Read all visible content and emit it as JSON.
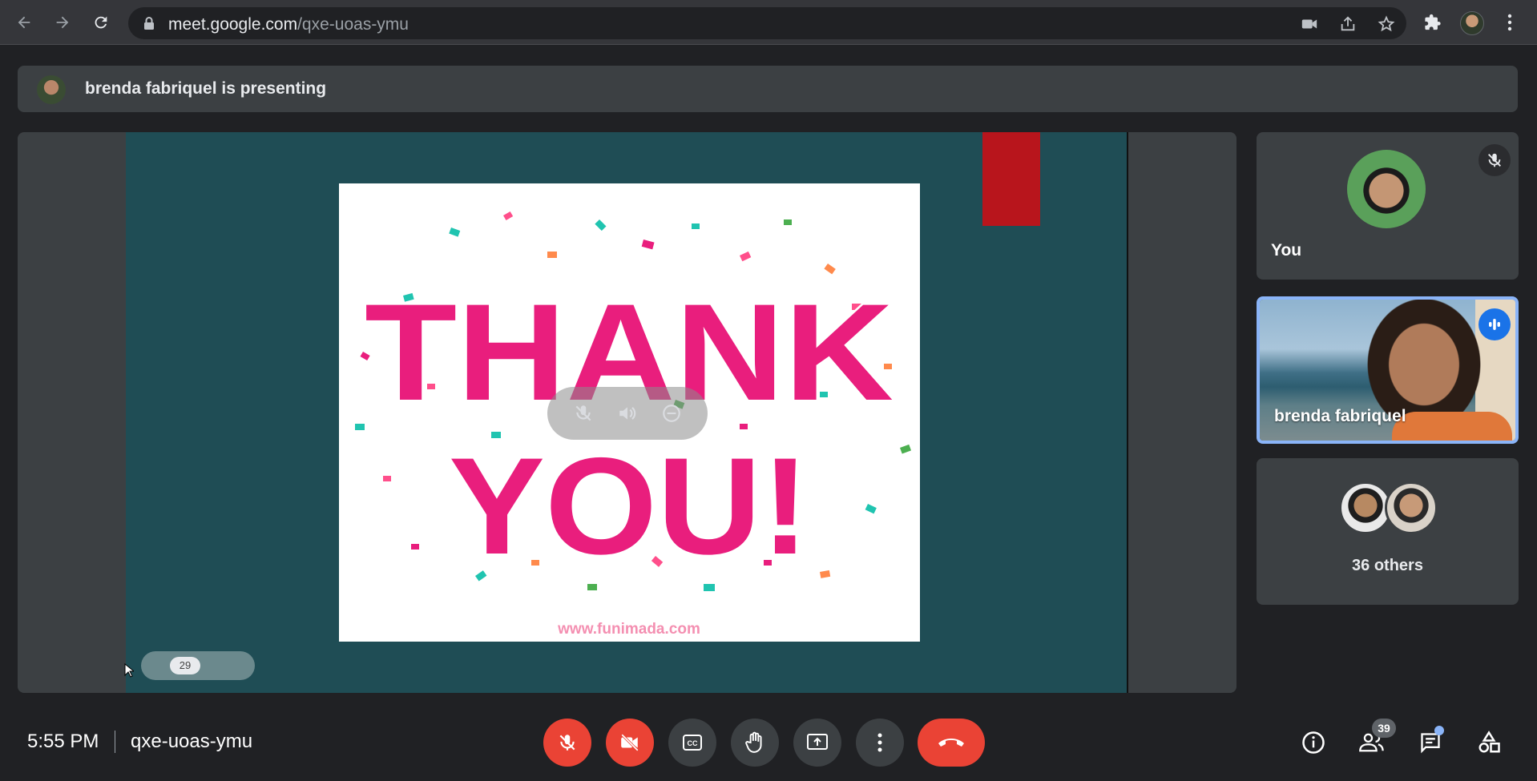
{
  "browser": {
    "url_host": "meet.google.com",
    "url_path": "/qxe-uoas-ymu"
  },
  "banner": {
    "text": "brenda fabriquel is presenting"
  },
  "presentation": {
    "slide_word1": "THANK",
    "slide_word2": "YOU!",
    "watermark": "www.funimada.com",
    "page_number": "29",
    "bg_color": "#1f4d55",
    "text_color": "#e91e7d"
  },
  "participants": {
    "you_label": "You",
    "presenter_label": "brenda fabriquel",
    "others_label": "36 others"
  },
  "bottom": {
    "time": "5:55 PM",
    "meeting_code": "qxe-uoas-ymu",
    "people_count": "39"
  },
  "colors": {
    "hangup": "#ea4335",
    "active_border": "#8ab4f8",
    "speaking": "#1a73e8"
  }
}
